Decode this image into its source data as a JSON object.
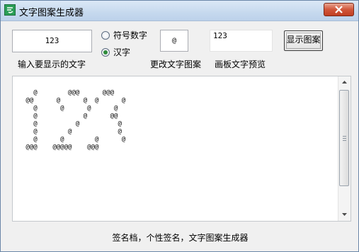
{
  "window": {
    "title": "文字图案生成器",
    "app_icon": "app-icon",
    "close_icon": "close-icon"
  },
  "controls": {
    "input_value": "123",
    "radio_symbol_label": "符号数字",
    "radio_hanzi_label": "汉字",
    "selected_mode": "汉字",
    "pattern_value": "@",
    "preview_text": "123",
    "show_button_label": "显示图案"
  },
  "labels": {
    "input_caption": "输入要显示的文字",
    "change_pattern_caption": "更改文字图案",
    "preview_caption": "画板文字预览"
  },
  "canvas": {
    "ascii_art": "   @        @@@      @@@\n @@      @      @  @      @\n   @      @      @      @\n   @            @      @@\n   @          @          @\n   @        @            @\n   @      @        @      @\n @@@    @@@@@    @@@",
    "scrollbar_grip_icon": "grip-icon",
    "scroll_up_icon": "arrow-up-icon",
    "scroll_down_icon": "arrow-down-icon"
  },
  "footer": {
    "text": "签名档，个性签名，文字图案生成器"
  }
}
